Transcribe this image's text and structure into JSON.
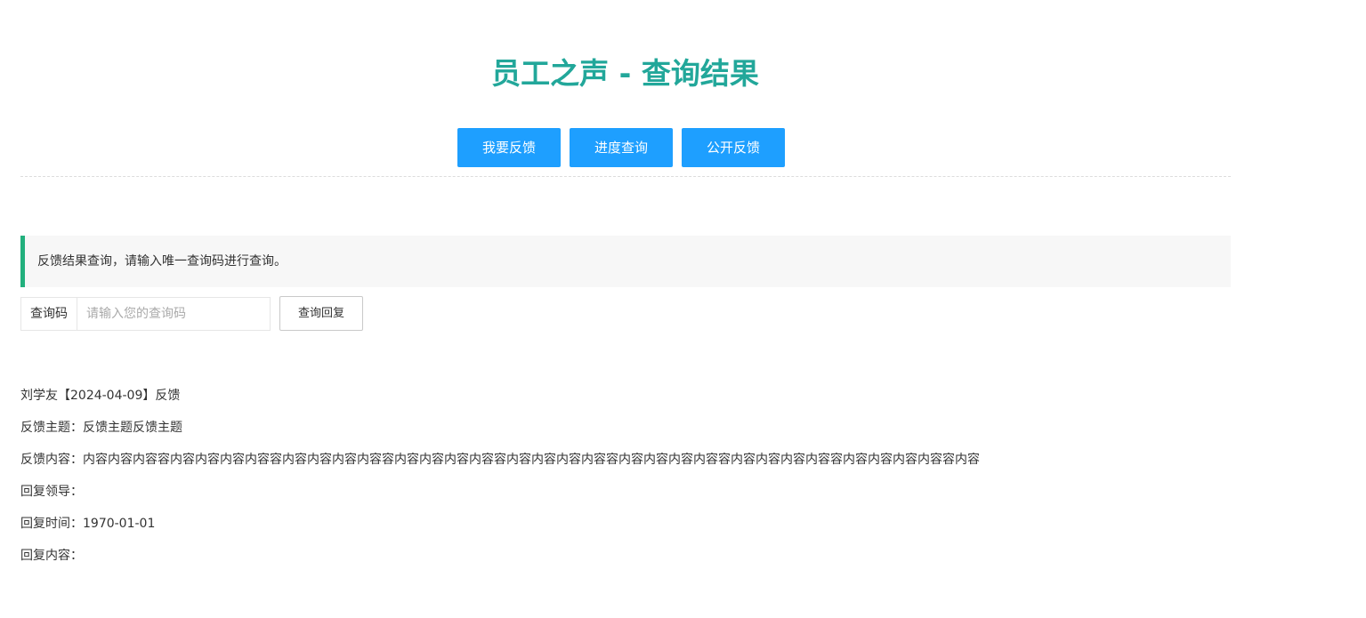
{
  "header": {
    "title": "员工之声 - 查询结果"
  },
  "nav": {
    "feedback_label": "我要反馈",
    "progress_label": "进度查询",
    "public_label": "公开反馈"
  },
  "notice": {
    "text": "反馈结果查询，请输入唯一查询码进行查询。"
  },
  "query": {
    "label": "查询码",
    "placeholder": "请输入您的查询码",
    "value": "",
    "button_label": "查询回复"
  },
  "result": {
    "header": "刘学友【2024-04-09】反馈",
    "subject_label": "反馈主题：",
    "subject_value": "反馈主题反馈主题",
    "content_label": "反馈内容：",
    "content_value": "内容内容内容容内容内容内容内容容内容内容内容内容容内容内容内容内容容内容内容内容内容容内容内容内容内容容内容内容内容内容容内容内容内容内容容内容",
    "leader_label": "回复领导：",
    "leader_value": "",
    "time_label": "回复时间：",
    "time_value": "1970-01-01",
    "reply_label": "回复内容：",
    "reply_value": ""
  },
  "colors": {
    "title": "#22a79a",
    "button_primary": "#1e9fff",
    "notice_accent": "#22b07d"
  }
}
